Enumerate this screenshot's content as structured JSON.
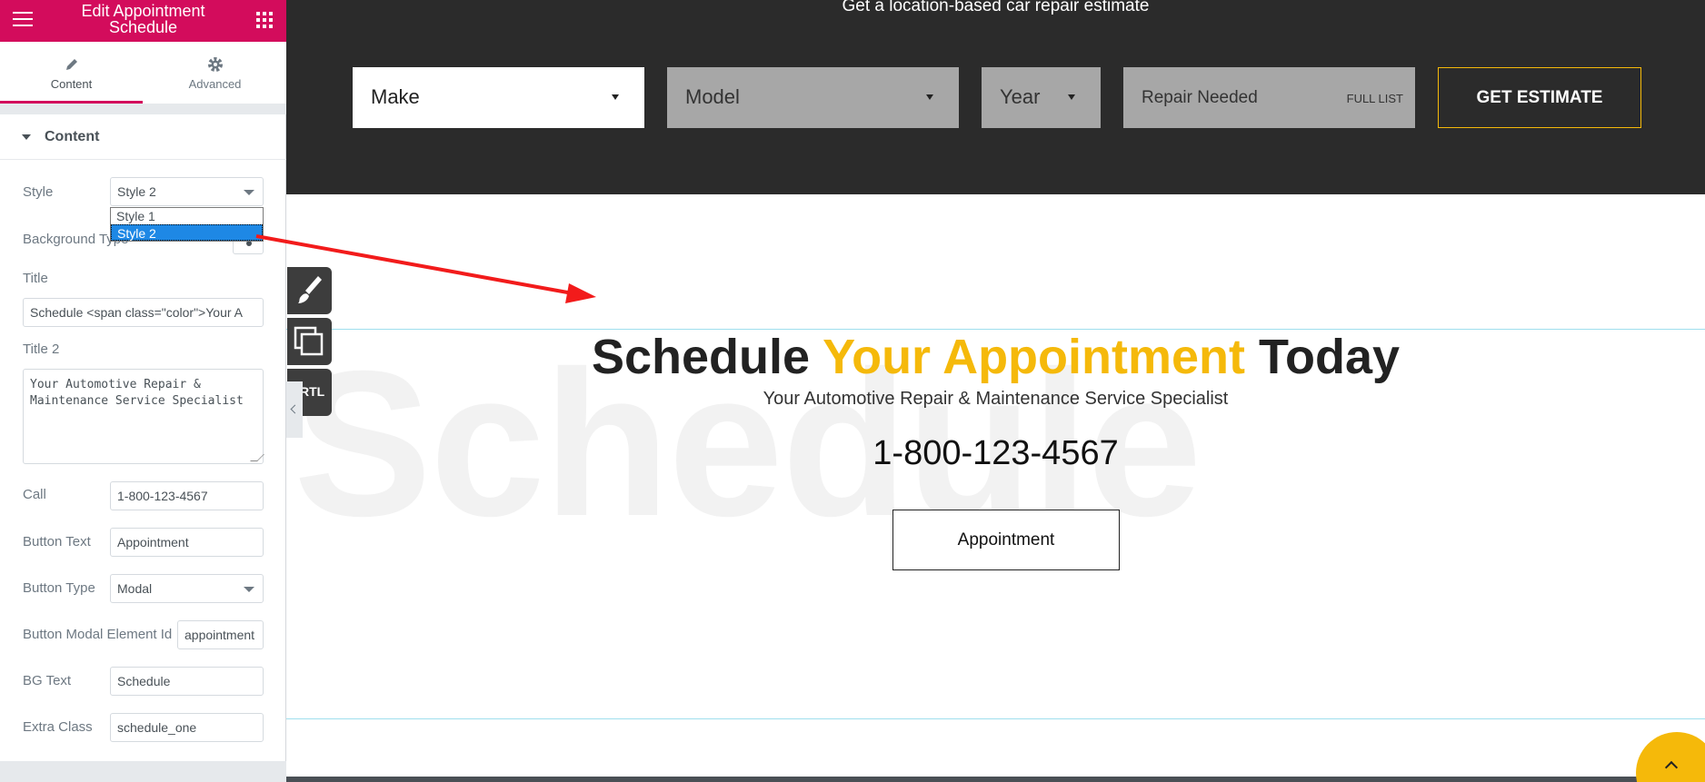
{
  "panel": {
    "title": "Edit Appointment Schedule",
    "tabs": [
      {
        "label": "Content",
        "icon": "pencil-icon"
      },
      {
        "label": "Advanced",
        "icon": "gear-icon"
      }
    ],
    "section_title": "Content",
    "accent_color": "#d30c5c"
  },
  "controls": {
    "style": {
      "label": "Style",
      "value": "Style 2",
      "options": [
        "Style 1",
        "Style 2"
      ]
    },
    "background_type": {
      "label": "Background Type"
    },
    "title": {
      "label": "Title",
      "value": "Schedule <span class=\"color\">Your A"
    },
    "title2": {
      "label": "Title 2",
      "value": "Your Automotive Repair &\nMaintenance Service Specialist"
    },
    "call": {
      "label": "Call",
      "value": "1-800-123-4567"
    },
    "button_text": {
      "label": "Button Text",
      "value": "Appointment"
    },
    "button_type": {
      "label": "Button Type",
      "value": "Modal"
    },
    "modal_id": {
      "label": "Button Modal Element Id",
      "value": "appointment"
    },
    "bg_text": {
      "label": "BG Text",
      "value": "Schedule"
    },
    "extra_class": {
      "label": "Extra Class",
      "value": "schedule_one"
    }
  },
  "estimate": {
    "heading": "Get a location-based car repair estimate",
    "make": "Make",
    "model": "Model",
    "year": "Year",
    "repair": "Repair Needed",
    "full_list": "FULL LIST",
    "button": "GET ESTIMATE"
  },
  "schedule": {
    "bg_text": "Schedule",
    "title_pre": "Schedule ",
    "title_highlight": "Your Appointment",
    "title_post": " Today",
    "subtitle": "Your Automotive Repair & Maintenance Service Specialist",
    "phone": "1-800-123-4567",
    "button": "Appointment",
    "highlight_color": "#f5b90a"
  },
  "tools": {
    "rtl": "RTL"
  }
}
